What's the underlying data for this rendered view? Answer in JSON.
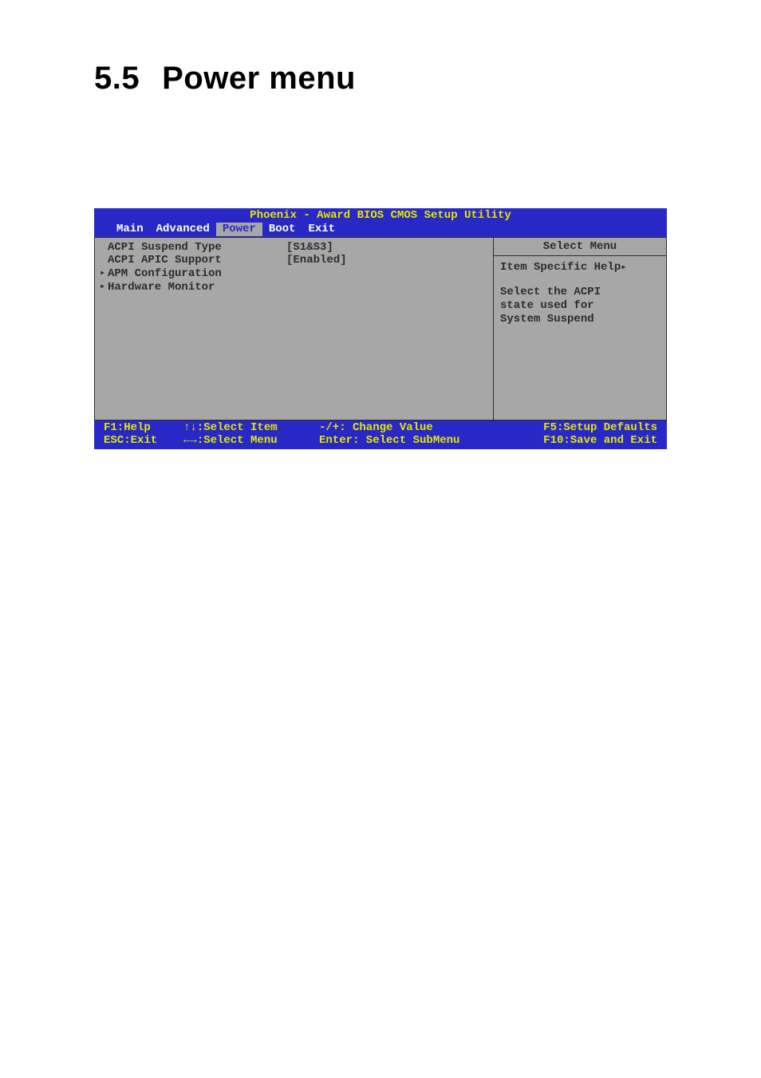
{
  "heading": {
    "number": "5.5",
    "title": "Power menu"
  },
  "bios": {
    "title": "Phoenix - Award BIOS CMOS Setup Utility",
    "menubar": {
      "items": [
        {
          "label": "Main"
        },
        {
          "label": "Advanced"
        },
        {
          "label": "Power"
        },
        {
          "label": "Boot"
        },
        {
          "label": "Exit"
        }
      ],
      "active_index": 2
    },
    "left": {
      "rows": [
        {
          "label": "ACPI Suspend Type",
          "value": "[S1&S3]",
          "submenu": false
        },
        {
          "label": "ACPI APIC Support",
          "value": "[Enabled]",
          "submenu": false
        },
        {
          "label": "APM Configuration",
          "value": "",
          "submenu": true
        },
        {
          "label": "Hardware Monitor",
          "value": "",
          "submenu": true
        }
      ]
    },
    "right": {
      "title": "Select Menu",
      "help_line": "Item Specific Help",
      "desc_lines": [
        "Select the ACPI",
        "state used for",
        "System Suspend"
      ]
    },
    "footer": {
      "rows": [
        {
          "c1": "F1:Help",
          "c2": "↑↓:Select Item",
          "c3": "-/+: Change Value",
          "c4": "F5:Setup Defaults"
        },
        {
          "c1": "ESC:Exit",
          "c2": "←→:Select Menu",
          "c3": "Enter: Select SubMenu",
          "c4": "F10:Save and Exit"
        }
      ]
    }
  }
}
